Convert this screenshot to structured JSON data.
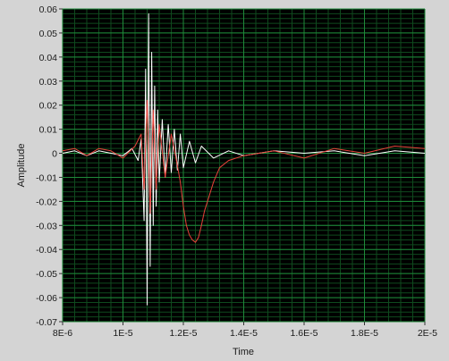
{
  "chart_data": {
    "type": "line",
    "xlabel": "Time",
    "ylabel": "Amplitude",
    "xlim": [
      8e-06,
      2e-05
    ],
    "ylim": [
      -0.07,
      0.06
    ],
    "x_ticks": [
      8e-06,
      1e-05,
      1.2e-05,
      1.4e-05,
      1.6e-05,
      1.8e-05,
      2e-05
    ],
    "x_tick_labels": [
      "8E-6",
      "1E-5",
      "1.2E-5",
      "1.4E-5",
      "1.6E-5",
      "1.8E-5",
      "2E-5"
    ],
    "y_ticks": [
      0.06,
      0.05,
      0.04,
      0.03,
      0.02,
      0.01,
      0,
      -0.01,
      -0.02,
      -0.03,
      -0.04,
      -0.05,
      -0.06,
      -0.07
    ],
    "y_tick_labels": [
      "0.06",
      "0.05",
      "0.04",
      "0.03",
      "0.02",
      "0.01",
      "0",
      "-0.01",
      "-0.02",
      "-0.03",
      "-0.04",
      "-0.05",
      "-0.06",
      "-0.07"
    ],
    "grid": true,
    "colors": {
      "background": "#000000",
      "major_grid": "#1f8a3a",
      "minor_grid": "#0f4a1e"
    },
    "series": [
      {
        "color": "#ffffff",
        "x": [
          8e-06,
          8.4e-06,
          8.8e-06,
          9.2e-06,
          9.6e-06,
          1e-05,
          1.03e-05,
          1.05e-05,
          1.06e-05,
          1.07e-05,
          1.075e-05,
          1.08e-05,
          1.085e-05,
          1.09e-05,
          1.095e-05,
          1.1e-05,
          1.105e-05,
          1.11e-05,
          1.115e-05,
          1.12e-05,
          1.13e-05,
          1.14e-05,
          1.15e-05,
          1.16e-05,
          1.17e-05,
          1.18e-05,
          1.19e-05,
          1.2e-05,
          1.22e-05,
          1.24e-05,
          1.26e-05,
          1.3e-05,
          1.35e-05,
          1.4e-05,
          1.5e-05,
          1.6e-05,
          1.7e-05,
          1.8e-05,
          1.9e-05,
          2e-05
        ],
        "y": [
          0,
          0.001,
          -0.001,
          0.001,
          0,
          -0.001,
          0.002,
          -0.003,
          0.006,
          -0.028,
          0.035,
          -0.063,
          0.058,
          -0.047,
          0.042,
          -0.03,
          0.028,
          -0.022,
          0.018,
          -0.012,
          0.014,
          -0.01,
          0.012,
          -0.008,
          0.01,
          -0.007,
          0.008,
          -0.006,
          0.005,
          -0.004,
          0.003,
          -0.002,
          0.001,
          -0.001,
          0.001,
          0,
          0.001,
          -0.001,
          0.001,
          0
        ]
      },
      {
        "color": "#e8423a",
        "x": [
          8e-06,
          8.4e-06,
          8.8e-06,
          9.2e-06,
          9.6e-06,
          1e-05,
          1.04e-05,
          1.06e-05,
          1.07e-05,
          1.08e-05,
          1.09e-05,
          1.1e-05,
          1.11e-05,
          1.12e-05,
          1.14e-05,
          1.16e-05,
          1.18e-05,
          1.19e-05,
          1.2e-05,
          1.21e-05,
          1.22e-05,
          1.23e-05,
          1.24e-05,
          1.25e-05,
          1.26e-05,
          1.27e-05,
          1.28e-05,
          1.3e-05,
          1.32e-05,
          1.35e-05,
          1.4e-05,
          1.5e-05,
          1.6e-05,
          1.7e-05,
          1.8e-05,
          1.9e-05,
          2e-05
        ],
        "y": [
          0.001,
          0.002,
          -0.001,
          0.002,
          0.001,
          -0.002,
          0.003,
          0.008,
          -0.015,
          0.022,
          -0.025,
          0.018,
          -0.015,
          0.012,
          -0.01,
          0.008,
          -0.005,
          -0.012,
          -0.022,
          -0.03,
          -0.034,
          -0.036,
          -0.037,
          -0.035,
          -0.03,
          -0.024,
          -0.02,
          -0.012,
          -0.006,
          -0.003,
          -0.001,
          0.001,
          -0.002,
          0.002,
          0,
          0.003,
          0.002
        ]
      }
    ]
  }
}
